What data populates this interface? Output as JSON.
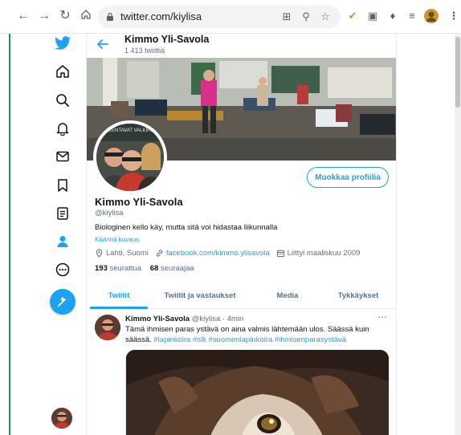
{
  "browser": {
    "url": "twitter.com/kiylisa"
  },
  "header": {
    "name": "Kimmo Yli-Savola",
    "tweet_count": "1 413 twiittiä"
  },
  "profile": {
    "edit_button": "Muokkaa profiilia",
    "name": "Kimmo Yli-Savola",
    "handle": "@kiylisa",
    "bio": "Biologinen kello käy, mutta sitä voi hidastaa liikunnalla",
    "translate": "Käännä kuvaus",
    "location": "Lahti, Suomi",
    "link": "facebook.com/kimmo.ylisavola",
    "joined": "Liittyi maaliskuu 2009",
    "following_count": "193",
    "following_label": "seurattua",
    "followers_count": "68",
    "followers_label": "seuraajaa",
    "banner_sign": "JAKEENTAVAT VALKIPELIT"
  },
  "tabs": [
    {
      "label": "Twiitit",
      "active": true
    },
    {
      "label": "Twiitit ja vastaukset",
      "active": false
    },
    {
      "label": "Media",
      "active": false
    },
    {
      "label": "Tykkäykset",
      "active": false
    }
  ],
  "tweet": {
    "author": "Kimmo Yli-Savola",
    "handle": "@kiylisa",
    "separator": "·",
    "time": "4min",
    "text": "Tämä ihmisen paras ystävä on aina valmis lähtemään ulos. Säässä kuin säässä.",
    "hashtags": "#lapinkoira #slk #suomenlapinkoira #ihmisenparasystävä"
  },
  "colors": {
    "accent": "#1da1f2",
    "secondary_text": "#5b7083"
  },
  "sidebar_icons": [
    "twitter-logo-icon",
    "home-icon",
    "explore-icon",
    "notifications-icon",
    "messages-icon",
    "bookmarks-icon",
    "lists-icon",
    "profile-icon",
    "more-icon",
    "compose-tweet-icon"
  ]
}
